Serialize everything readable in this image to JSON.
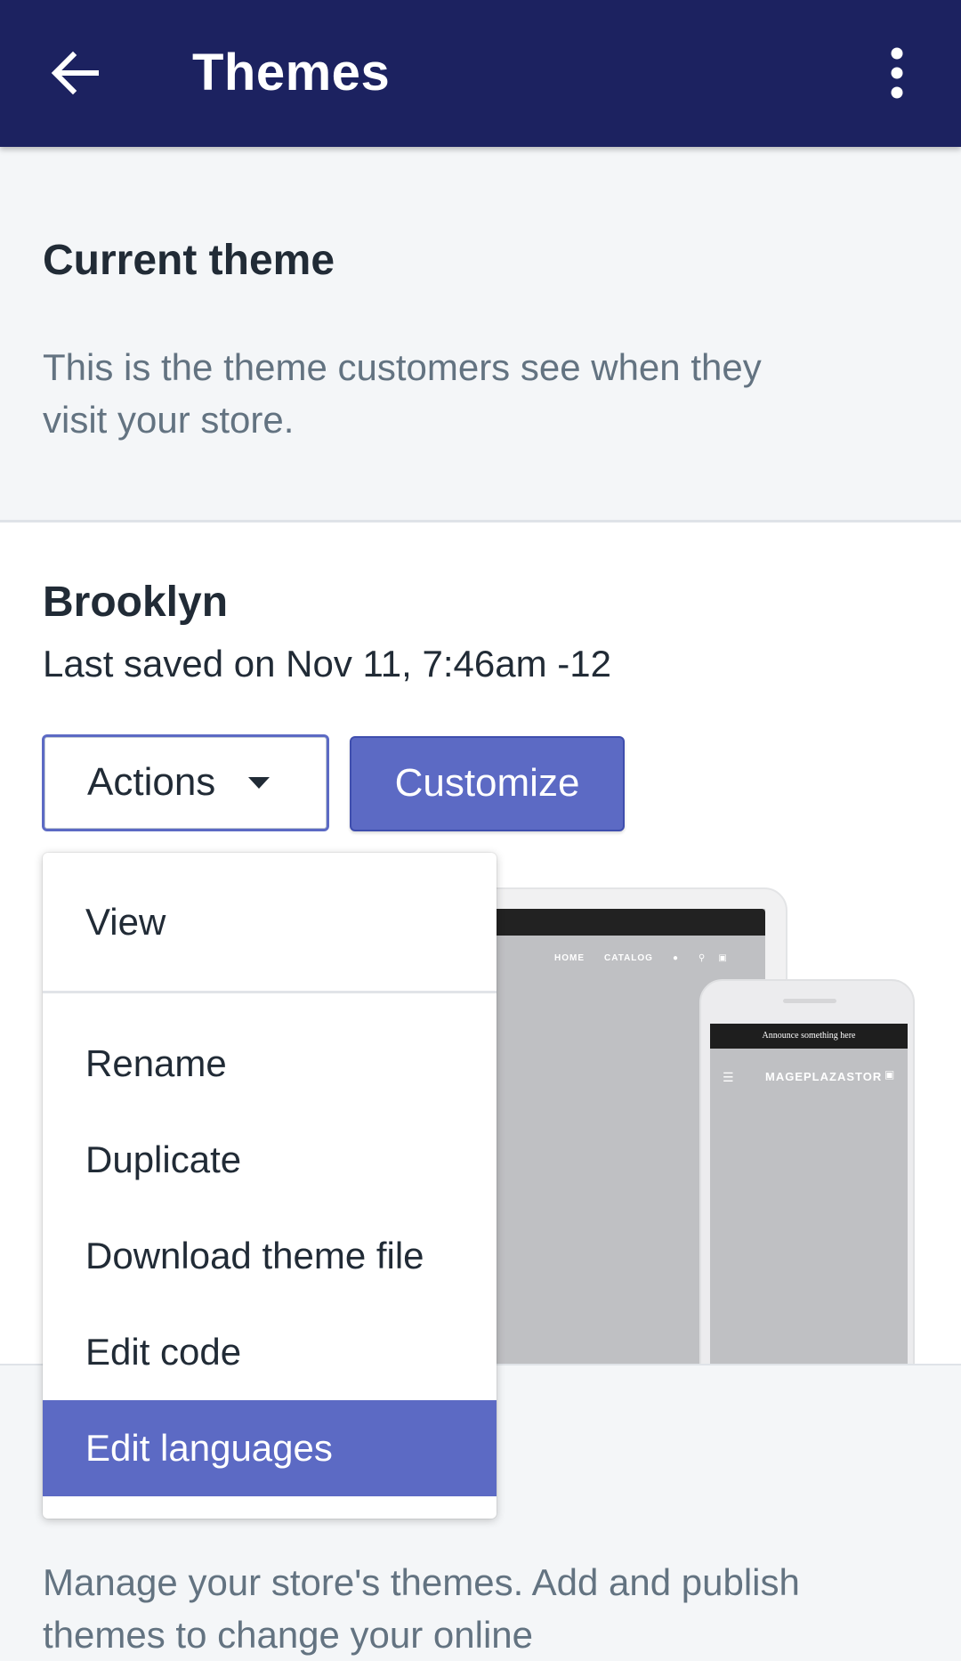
{
  "appbar": {
    "title": "Themes",
    "back_icon": "arrow-left-icon",
    "more_icon": "more-vertical-icon"
  },
  "intro": {
    "heading": "Current theme",
    "description": "This is the theme customers see when they visit your store."
  },
  "theme": {
    "name": "Brooklyn",
    "last_saved": "Last saved on Nov 11, 7:46am -12",
    "actions_label": "Actions",
    "customize_label": "Customize"
  },
  "actions_menu": {
    "items": [
      {
        "label": "View"
      },
      {
        "label": "Rename"
      },
      {
        "label": "Duplicate"
      },
      {
        "label": "Download theme file"
      },
      {
        "label": "Edit code"
      },
      {
        "label": "Edit languages",
        "selected": true
      }
    ]
  },
  "preview": {
    "tablet_links": [
      "HOME",
      "CATALOG"
    ],
    "phone_banner": "Announce something here",
    "phone_brand": "MAGEPLAZASTOR"
  },
  "footer": {
    "manage_text": "Manage your store's themes. Add and publish themes to change your online"
  },
  "colors": {
    "appbar": "#1c2260",
    "accent": "#5c6ac4",
    "text": "#212b36",
    "subdued": "#637381"
  }
}
